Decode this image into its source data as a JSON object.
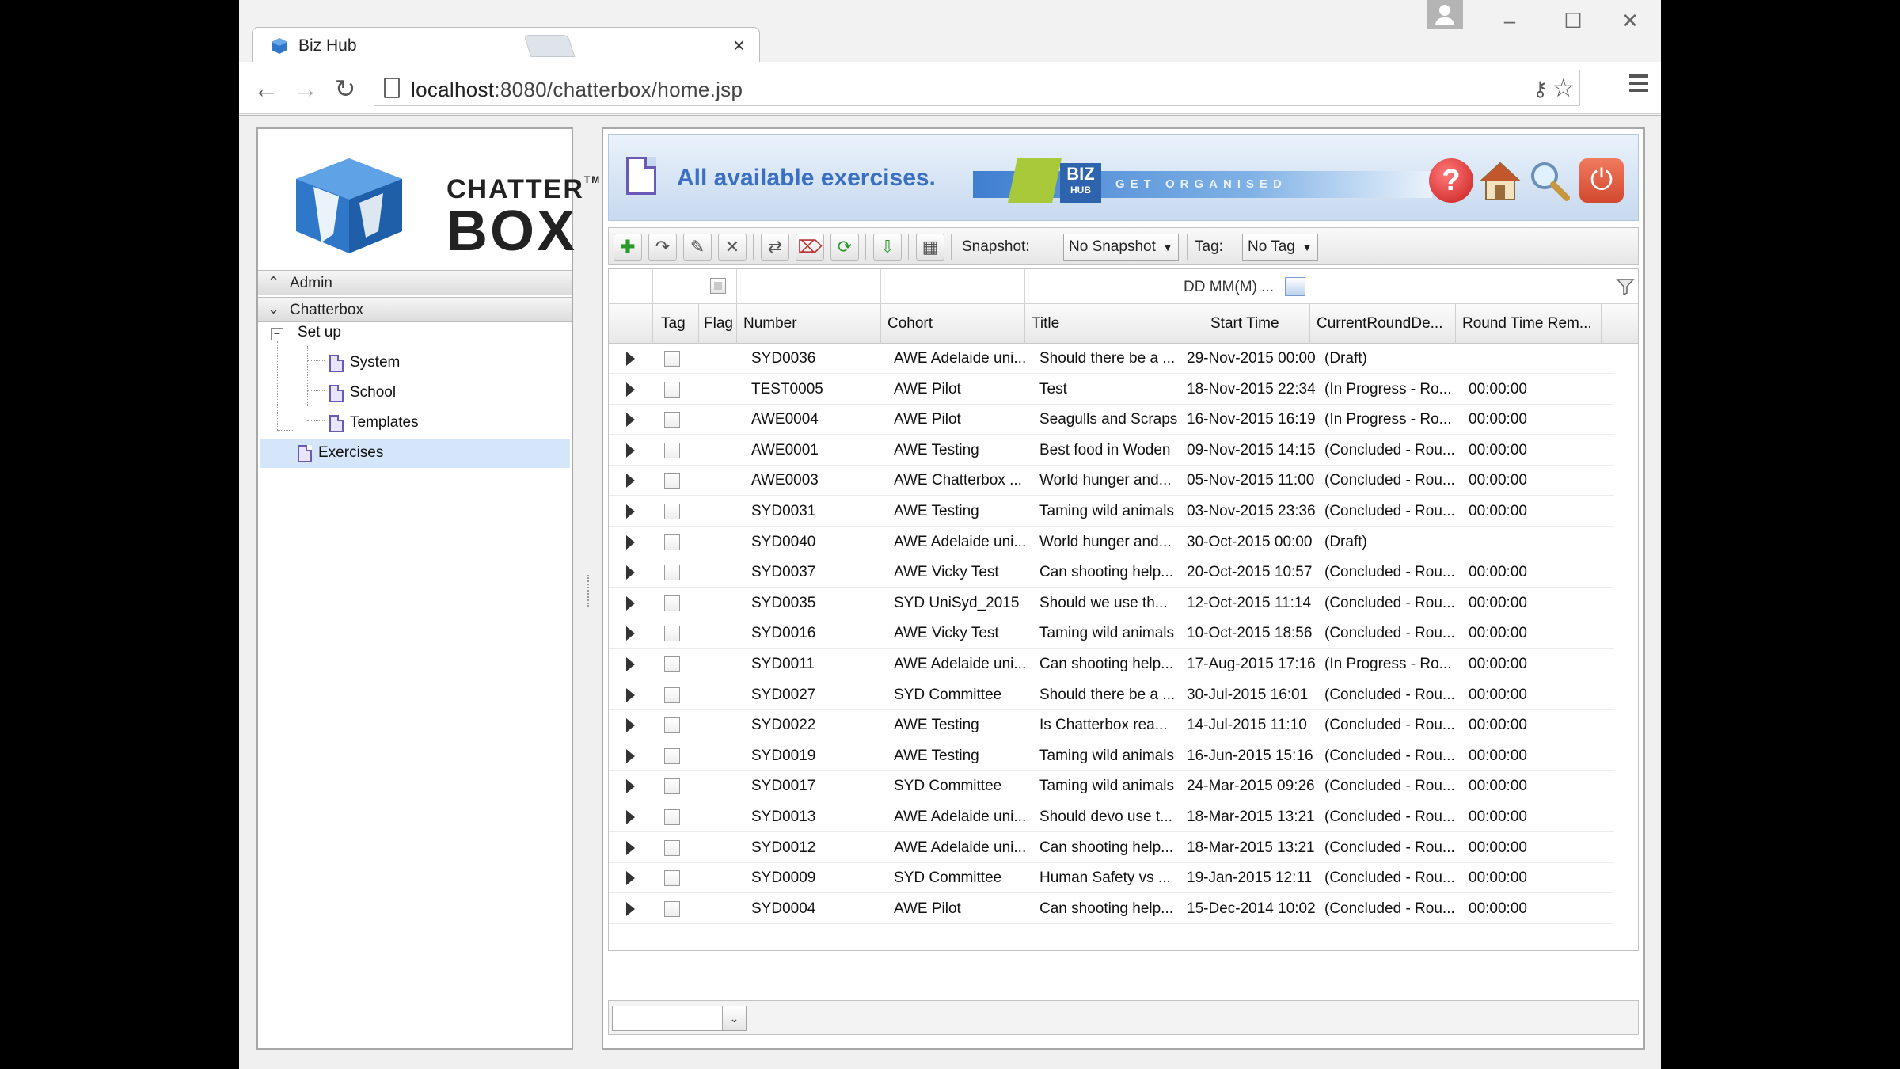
{
  "browser": {
    "tab_title": "Biz Hub",
    "tab_close": "×",
    "url_host": "localhost",
    "url_path": ":8080/chatterbox/home.jsp",
    "window_controls": {
      "minimize": "–",
      "maximize": "☐",
      "close": "✕"
    },
    "nav": {
      "back": "←",
      "forward": "→",
      "reload": "↻"
    }
  },
  "sidebar": {
    "logo": {
      "line1": "CHATTER",
      "tm": "TM",
      "line2": "BOX"
    },
    "sections": [
      {
        "label": "Admin",
        "expanded": false
      },
      {
        "label": "Chatterbox",
        "expanded": true
      }
    ],
    "tree": {
      "root": "Set up",
      "children": [
        "System",
        "School",
        "Templates"
      ],
      "exercises": "Exercises"
    }
  },
  "banner": {
    "title": "All available exercises.",
    "bizhub_line1": "BIZ",
    "bizhub_line2": "HUB",
    "slogan": "GET ORGANISED",
    "help": "?",
    "power": "⏻"
  },
  "toolbar": {
    "snapshot_label": "Snapshot:",
    "snapshot_value": "No Snapshot",
    "tag_label": "Tag:",
    "tag_value": "No Tag"
  },
  "grid": {
    "date_filter_placeholder": "DD MM(M) ...",
    "columns": [
      "Tag",
      "Flag",
      "Number",
      "Cohort",
      "Title",
      "Start Time",
      "CurrentRoundDe...",
      "Round Time Rem..."
    ],
    "rows": [
      {
        "number": "SYD0036",
        "cohort": "AWE Adelaide uni...",
        "title": "Should there be a ...",
        "start": "29-Nov-2015 00:00",
        "round": "(Draft)",
        "remaining": ""
      },
      {
        "number": "TEST0005",
        "cohort": "AWE Pilot",
        "title": "Test",
        "start": "18-Nov-2015 22:34",
        "round": "(In Progress - Ro...",
        "remaining": "00:00:00"
      },
      {
        "number": "AWE0004",
        "cohort": "AWE Pilot",
        "title": "Seagulls and Scraps",
        "start": "16-Nov-2015 16:19",
        "round": "(In Progress - Ro...",
        "remaining": "00:00:00"
      },
      {
        "number": "AWE0001",
        "cohort": "AWE Testing",
        "title": "Best food in Woden",
        "start": "09-Nov-2015 14:15",
        "round": "(Concluded - Rou...",
        "remaining": "00:00:00"
      },
      {
        "number": "AWE0003",
        "cohort": "AWE Chatterbox ...",
        "title": "World hunger and...",
        "start": "05-Nov-2015 11:00",
        "round": "(Concluded - Rou...",
        "remaining": "00:00:00"
      },
      {
        "number": "SYD0031",
        "cohort": "AWE Testing",
        "title": "Taming wild animals",
        "start": "03-Nov-2015 23:36",
        "round": "(Concluded - Rou...",
        "remaining": "00:00:00"
      },
      {
        "number": "SYD0040",
        "cohort": "AWE Adelaide uni...",
        "title": "World hunger and...",
        "start": "30-Oct-2015 00:00",
        "round": "(Draft)",
        "remaining": ""
      },
      {
        "number": "SYD0037",
        "cohort": "AWE Vicky Test",
        "title": "Can shooting help...",
        "start": "20-Oct-2015 10:57",
        "round": "(Concluded - Rou...",
        "remaining": "00:00:00"
      },
      {
        "number": "SYD0035",
        "cohort": "SYD UniSyd_2015",
        "title": "Should we use th...",
        "start": "12-Oct-2015 11:14",
        "round": "(Concluded - Rou...",
        "remaining": "00:00:00"
      },
      {
        "number": "SYD0016",
        "cohort": "AWE Vicky Test",
        "title": "Taming wild animals",
        "start": "10-Oct-2015 18:56",
        "round": "(Concluded - Rou...",
        "remaining": "00:00:00"
      },
      {
        "number": "SYD0011",
        "cohort": "AWE Adelaide uni...",
        "title": "Can shooting help...",
        "start": "17-Aug-2015 17:16",
        "round": "(In Progress - Ro...",
        "remaining": "00:00:00"
      },
      {
        "number": "SYD0027",
        "cohort": "SYD Committee",
        "title": "Should there be a ...",
        "start": "30-Jul-2015 16:01",
        "round": "(Concluded - Rou...",
        "remaining": "00:00:00"
      },
      {
        "number": "SYD0022",
        "cohort": "AWE Testing",
        "title": "Is Chatterbox rea...",
        "start": "14-Jul-2015 11:10",
        "round": "(Concluded - Rou...",
        "remaining": "00:00:00"
      },
      {
        "number": "SYD0019",
        "cohort": "AWE Testing",
        "title": "Taming wild animals",
        "start": "16-Jun-2015 15:16",
        "round": "(Concluded - Rou...",
        "remaining": "00:00:00"
      },
      {
        "number": "SYD0017",
        "cohort": "SYD Committee",
        "title": "Taming wild animals",
        "start": "24-Mar-2015 09:26",
        "round": "(Concluded - Rou...",
        "remaining": "00:00:00"
      },
      {
        "number": "SYD0013",
        "cohort": "AWE Adelaide uni...",
        "title": "Should devo use t...",
        "start": "18-Mar-2015 13:21",
        "round": "(Concluded - Rou...",
        "remaining": "00:00:00"
      },
      {
        "number": "SYD0012",
        "cohort": "AWE Adelaide uni...",
        "title": "Can shooting help...",
        "start": "18-Mar-2015 13:21",
        "round": "(Concluded - Rou...",
        "remaining": "00:00:00"
      },
      {
        "number": "SYD0009",
        "cohort": "SYD Committee",
        "title": "Human Safety vs ...",
        "start": "19-Jan-2015 12:11",
        "round": "(Concluded - Rou...",
        "remaining": "00:00:00"
      },
      {
        "number": "SYD0004",
        "cohort": "AWE Pilot",
        "title": "Can shooting help...",
        "start": "15-Dec-2014 10:02",
        "round": "(Concluded - Rou...",
        "remaining": "00:00:00"
      }
    ]
  },
  "colors": {
    "banner_title": "#3a6fc1",
    "selection": "#d5e5fa",
    "logo_blue": "#2f77c9"
  }
}
